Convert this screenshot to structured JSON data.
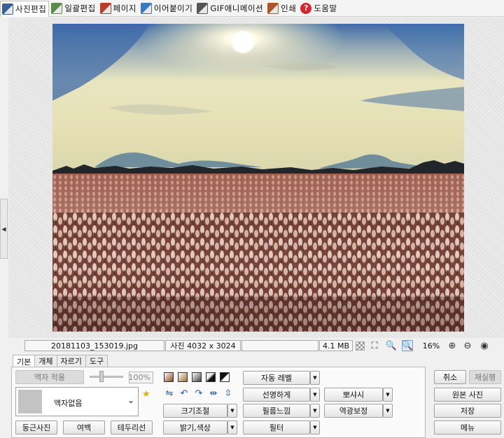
{
  "tabs": [
    {
      "label": "사진편집",
      "icon": "photo-edit-icon",
      "color": "#3a5f9c",
      "active": true
    },
    {
      "label": "일괄편집",
      "icon": "batch-edit-icon",
      "color": "#5a8a4a",
      "active": false
    },
    {
      "label": "페이지",
      "icon": "page-icon",
      "color": "#c0392b",
      "active": false
    },
    {
      "label": "이어붙이기",
      "icon": "merge-icon",
      "color": "#3b78c4",
      "active": false
    },
    {
      "label": "GIF애니메이션",
      "icon": "gif-animation-icon",
      "color": "#555555",
      "active": false
    },
    {
      "label": "인쇄",
      "icon": "print-icon",
      "color": "#b0542a",
      "active": false
    },
    {
      "label": "도움말",
      "icon": "help-icon",
      "color": "#d9242a",
      "active": false
    }
  ],
  "help_glyph": "?",
  "status": {
    "filename": "20181103_153019.jpg",
    "dimensions": "사진 4032 x 3024",
    "extra": "",
    "filesize": "4.1 MB",
    "zoom": "16%"
  },
  "lower_tabs": [
    "기본",
    "개체",
    "자르기",
    "도구"
  ],
  "panel": {
    "frame_apply": "액자 적용",
    "opacity": "100%",
    "frame_select": "액자없음",
    "rounded_photo": "둥근사진",
    "margin": "여백",
    "border_line": "테두리선",
    "auto_level": "자동 레벨",
    "sharpen": "선명하게",
    "film_look": "필름느낌",
    "filter": "필터",
    "resize": "크기조절",
    "brightness_color": "밝기,색상",
    "bokeh": "뽀샤시",
    "backlight_fix": "역광보정"
  },
  "right_panel": {
    "cancel": "취소",
    "redo": "재실행",
    "original_photo": "원본 사진",
    "save": "저장",
    "menu": "메뉴"
  },
  "colors": {
    "accent": "#3a5f9c",
    "sky_top": "#4e6f9e",
    "sky_haze": "#e6e2b8",
    "field": "#7a3a2a",
    "reeds": "#e8cfc0"
  }
}
